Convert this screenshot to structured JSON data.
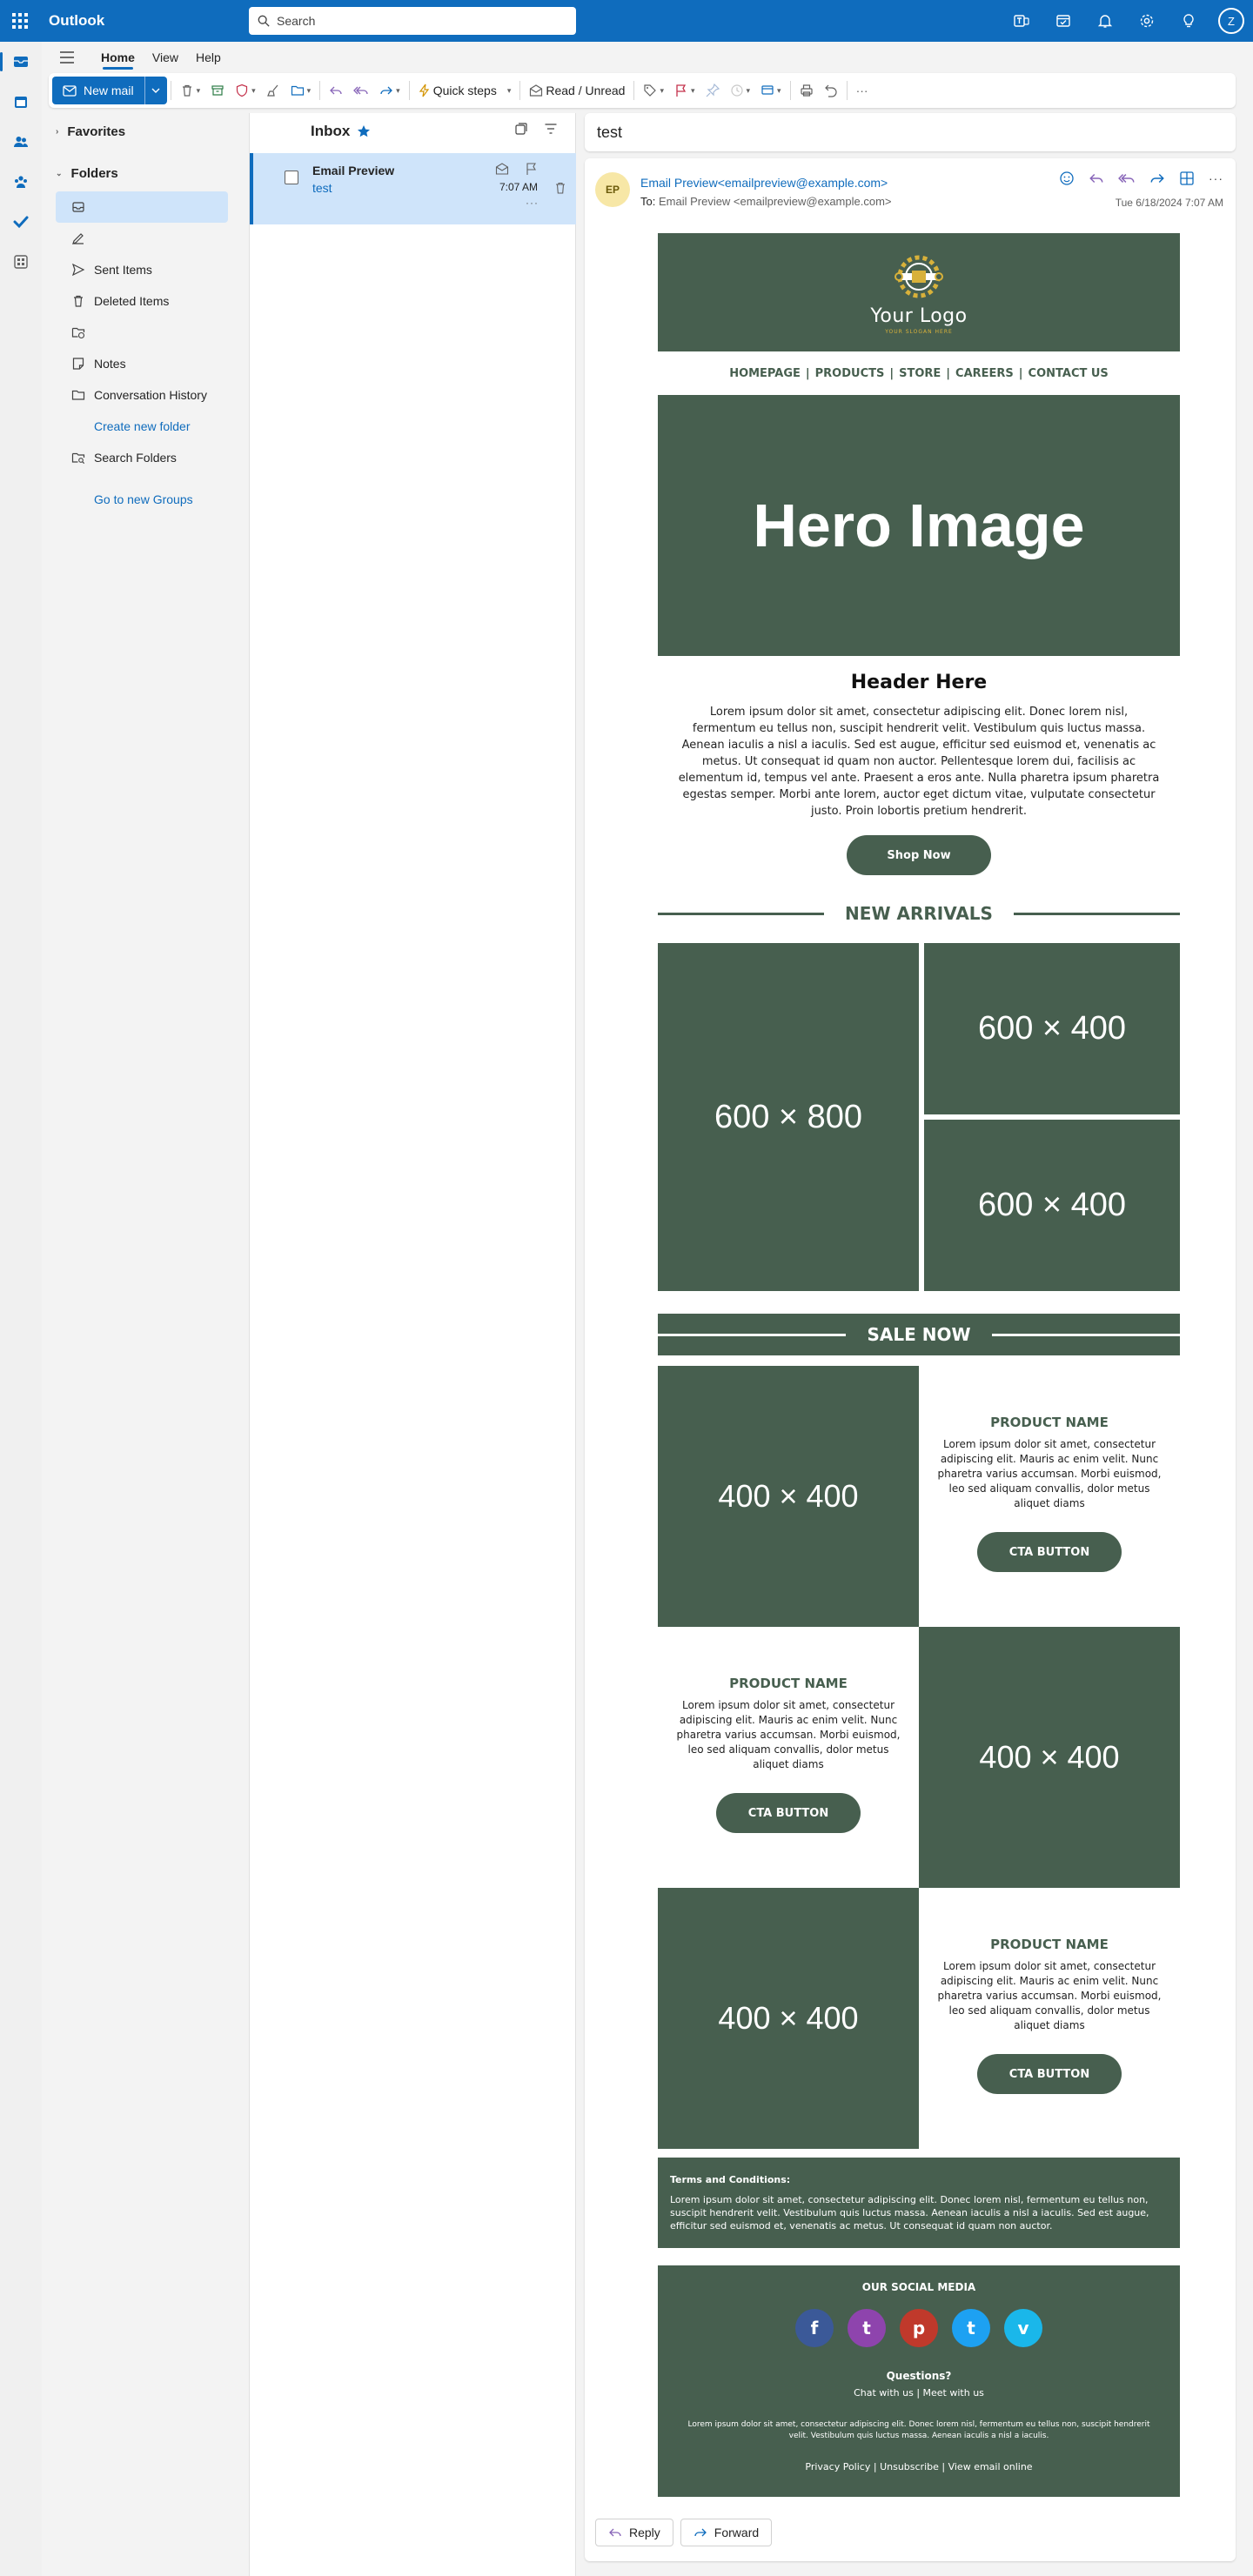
{
  "app": {
    "name": "Outlook"
  },
  "search": {
    "placeholder": "Search"
  },
  "user": {
    "initial": "Z"
  },
  "ribbon_tabs": [
    "Home",
    "View",
    "Help"
  ],
  "ribbon": {
    "new_mail": "New mail",
    "quick_steps": "Quick steps",
    "read_unread": "Read / Unread",
    "more": "···"
  },
  "folders": {
    "favorites": "Favorites",
    "folders": "Folders",
    "items": [
      "Sent Items",
      "Deleted Items",
      "Notes",
      "Conversation History",
      "Search Folders"
    ],
    "create_new_folder": "Create new folder",
    "go_to_groups": "Go to new Groups"
  },
  "message_list": {
    "title": "Inbox",
    "message": {
      "sender": "Email Preview",
      "subject": "test",
      "time": "7:07 AM",
      "more": "···"
    }
  },
  "reading": {
    "subject": "test",
    "avatar": "EP",
    "from": "Email Preview<emailpreview@example.com>",
    "to_label": "To:",
    "to": "Email Preview <emailpreview@example.com>",
    "date": "Tue 6/18/2024 7:07 AM",
    "reply": "Reply",
    "forward": "Forward"
  },
  "email": {
    "logo_name": "Your Logo",
    "logo_slogan": "YOUR SLOGAN HERE",
    "nav": [
      "HOMEPAGE",
      "PRODUCTS",
      "STORE",
      "CAREERS",
      "CONTACT US"
    ],
    "nav_sep": "|",
    "hero": "Hero Image",
    "header": "Header Here",
    "intro": "Lorem ipsum dolor sit amet, consectetur adipiscing elit. Donec lorem nisl, fermentum eu tellus non, suscipit hendrerit velit. Vestibulum quis luctus massa. Aenean iaculis a nisl a iaculis. Sed est augue, efficitur sed euismod et, venenatis ac metus. Ut consequat id quam non auctor. Pellentesque lorem dui, facilisis ac elementum id, tempus vel ante. Praesent a eros ante. Nulla pharetra ipsum pharetra egestas semper. Morbi ante lorem, auctor eget dictum vitae, vulputate consectetur justo. Proin lobortis pretium hendrerit.",
    "shop_now": "Shop Now",
    "new_arrivals": "NEW ARRIVALS",
    "ph_large": "600 × 800",
    "ph_small_1": "600 × 400",
    "ph_small_2": "600 × 400",
    "sale_now": "SALE NOW",
    "products": [
      {
        "placeholder": "400 × 400",
        "name": "PRODUCT NAME",
        "desc": "Lorem ipsum dolor sit amet, consectetur adipiscing elit. Mauris ac enim velit. Nunc pharetra varius accumsan. Morbi euismod, leo sed aliquam convallis, dolor metus aliquet diams",
        "cta": "CTA BUTTON"
      },
      {
        "placeholder": "400 × 400",
        "name": "PRODUCT NAME",
        "desc": "Lorem ipsum dolor sit amet, consectetur adipiscing elit. Mauris ac enim velit. Nunc pharetra varius accumsan. Morbi euismod, leo sed aliquam convallis, dolor metus aliquet diams",
        "cta": "CTA BUTTON"
      },
      {
        "placeholder": "400 × 400",
        "name": "PRODUCT NAME",
        "desc": "Lorem ipsum dolor sit amet, consectetur adipiscing elit. Mauris ac enim velit. Nunc pharetra varius accumsan. Morbi euismod, leo sed aliquam convallis, dolor metus aliquet diams",
        "cta": "CTA BUTTON"
      }
    ],
    "terms_title": "Terms and Conditions:",
    "terms_text": "Lorem ipsum dolor sit amet, consectetur adipiscing elit. Donec lorem nisl, fermentum eu tellus non, suscipit hendrerit velit. Vestibulum quis luctus massa. Aenean iaculis a nisl a iaculis. Sed est augue, efficitur sed euismod et, venenatis ac metus. Ut consequat id quam non auctor.",
    "social_title": "OUR SOCIAL MEDIA",
    "social": [
      {
        "name": "facebook-icon",
        "glyph": "f",
        "color": "#3b5998"
      },
      {
        "name": "twitch-icon",
        "glyph": "t",
        "color": "#8e44ad"
      },
      {
        "name": "pinterest-icon",
        "glyph": "p",
        "color": "#c0392b"
      },
      {
        "name": "twitter-icon",
        "glyph": "t",
        "color": "#1da1f2"
      },
      {
        "name": "vimeo-icon",
        "glyph": "v",
        "color": "#1ab7ea"
      }
    ],
    "questions": "Questions?",
    "chat_with_us": "Chat with us",
    "meet_with_us": "Meet with us",
    "footer_text": "Lorem ipsum dolor sit amet, consectetur adipiscing elit. Donec lorem nisl, fermentum eu tellus non, suscipit hendrerit velit. Vestibulum quis luctus massa. Aenean iaculis a nisl a iaculis.",
    "privacy": "Privacy Policy",
    "unsubscribe": "Unsubscribe",
    "view_online": "View email online"
  },
  "colors": {
    "brand": "#0f6cbd",
    "template_green": "#475f4f",
    "selection": "#cfe4fa"
  }
}
